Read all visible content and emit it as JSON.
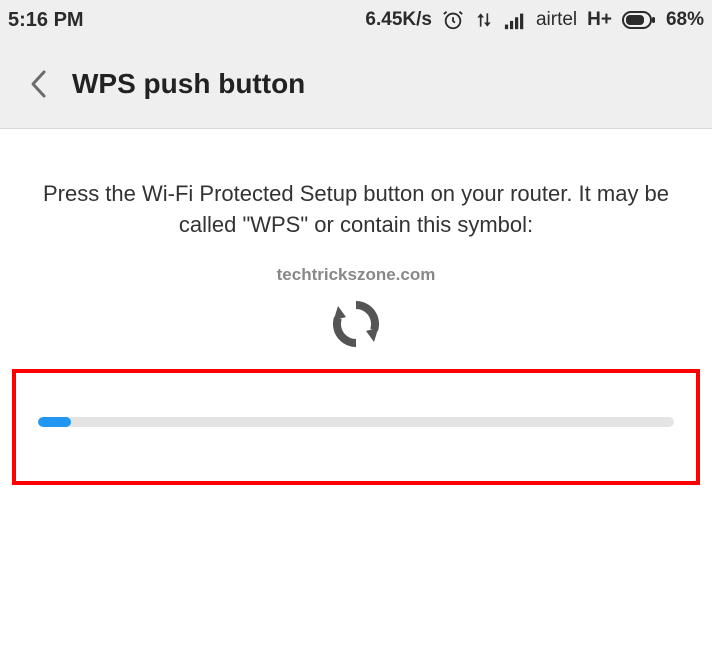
{
  "statusbar": {
    "time": "5:16 PM",
    "data_speed": "6.45K/s",
    "carrier": "airtel",
    "network_type": "H+",
    "battery_percent": "68%"
  },
  "header": {
    "title": "WPS push button"
  },
  "main": {
    "instruction": "Press the Wi-Fi Protected Setup button on your router. It may be called \"WPS\" or contain this symbol:",
    "watermark": "techtrickszone.com",
    "progress_percent": 5.2
  }
}
